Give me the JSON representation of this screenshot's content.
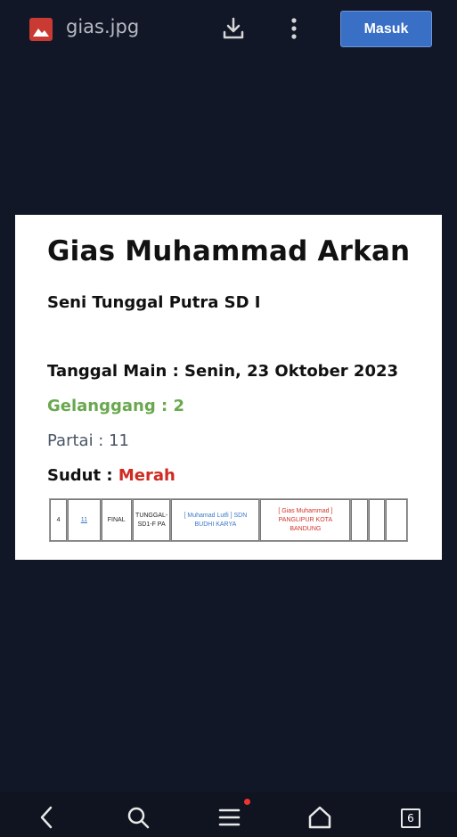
{
  "header": {
    "file_name": "gias.jpg",
    "login_label": "Masuk",
    "icons": [
      "image-file-icon",
      "download-icon",
      "more-vert-icon"
    ]
  },
  "card": {
    "name": "Gias Muhammad Arkan",
    "category": "Seni Tunggal Putra SD I",
    "date_line": "Tanggal Main : Senin, 23 Oktober 2023",
    "arena_line": "Gelanggang : 2",
    "match_line": "Partai : 11",
    "corner_label": "Sudut : ",
    "corner_value": "Merah",
    "arena_color": "#6aa84f",
    "corner_color": "#d02a22"
  },
  "bracket_row": {
    "no": "4",
    "partai": "11",
    "round": "FINAL",
    "class": "TUNGGAL-SD1-F PA",
    "blue_corner": "[ Muhamad Lutfi ] SDN BUDHI KARYA",
    "red_corner": "[ Gias Muhammad ] PANGLIPUR KOTA BANDUNG",
    "empty1": "",
    "empty2": "",
    "empty3": ""
  },
  "bottom_nav": {
    "tab_count": "6",
    "icons": [
      "back-icon",
      "search-icon",
      "menu-icon",
      "home-icon",
      "tabs-icon"
    ]
  }
}
